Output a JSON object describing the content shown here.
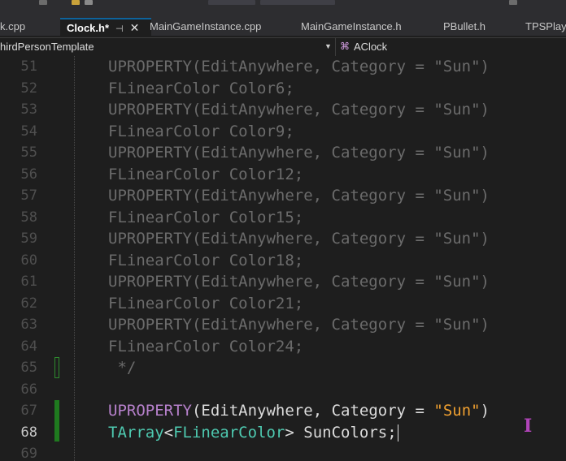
{
  "tabs": [
    {
      "label": "k.cpp",
      "active": false
    },
    {
      "label": "Clock.h*",
      "active": true,
      "pin": "⊣",
      "close": "✕"
    },
    {
      "label": "MainGameInstance.cpp",
      "active": false
    },
    {
      "label": "MainGameInstance.h",
      "active": false
    },
    {
      "label": "PBullet.h",
      "active": false
    },
    {
      "label": "TPSPlaye",
      "active": false
    }
  ],
  "navbar": {
    "project": "hirdPersonTemplate",
    "class_icon": "class-icon",
    "class_name": "AClock"
  },
  "editor": {
    "lines": [
      {
        "num": "51",
        "text": "UPROPERTY(EditAnywhere, Category = \"Sun\")"
      },
      {
        "num": "52",
        "text": "FLinearColor Color6;"
      },
      {
        "num": "53",
        "text": "UPROPERTY(EditAnywhere, Category = \"Sun\")"
      },
      {
        "num": "54",
        "text": "FLinearColor Color9;"
      },
      {
        "num": "55",
        "text": "UPROPERTY(EditAnywhere, Category = \"Sun\")"
      },
      {
        "num": "56",
        "text": "FLinearColor Color12;"
      },
      {
        "num": "57",
        "text": "UPROPERTY(EditAnywhere, Category = \"Sun\")"
      },
      {
        "num": "58",
        "text": "FLinearColor Color15;"
      },
      {
        "num": "59",
        "text": "UPROPERTY(EditAnywhere, Category = \"Sun\")"
      },
      {
        "num": "60",
        "text": "FLinearColor Color18;"
      },
      {
        "num": "61",
        "text": "UPROPERTY(EditAnywhere, Category = \"Sun\")"
      },
      {
        "num": "62",
        "text": "FLinearColor Color21;"
      },
      {
        "num": "63",
        "text": "UPROPERTY(EditAnywhere, Category = \"Sun\")"
      },
      {
        "num": "64",
        "text": "FLinearColor Color24;"
      },
      {
        "num": "65",
        "text": " */"
      },
      {
        "num": "66",
        "text": ""
      },
      {
        "num": "67",
        "macro": "UPROPERTY",
        "open": "(",
        "arg1": "EditAnywhere",
        "comma": ", ",
        "arg2": "Category",
        "eq": " = ",
        "str": "\"Sun\"",
        "close": ")"
      },
      {
        "num": "68",
        "type": "TArray",
        "lt": "<",
        "inner": "FLinearColor",
        "gt": ">",
        "rest": " SunColors;"
      },
      {
        "num": "69",
        "text": ""
      }
    ],
    "current_line": "68"
  },
  "colors": {
    "background": "#1e1e1e",
    "comment_gray": "#6b6b6b",
    "macro": "#b781cc",
    "type": "#4ec9b0",
    "string": "#d69d85",
    "change_marker": "#1f7a1f"
  },
  "cursor_icon": "i-beam-cursor-icon"
}
